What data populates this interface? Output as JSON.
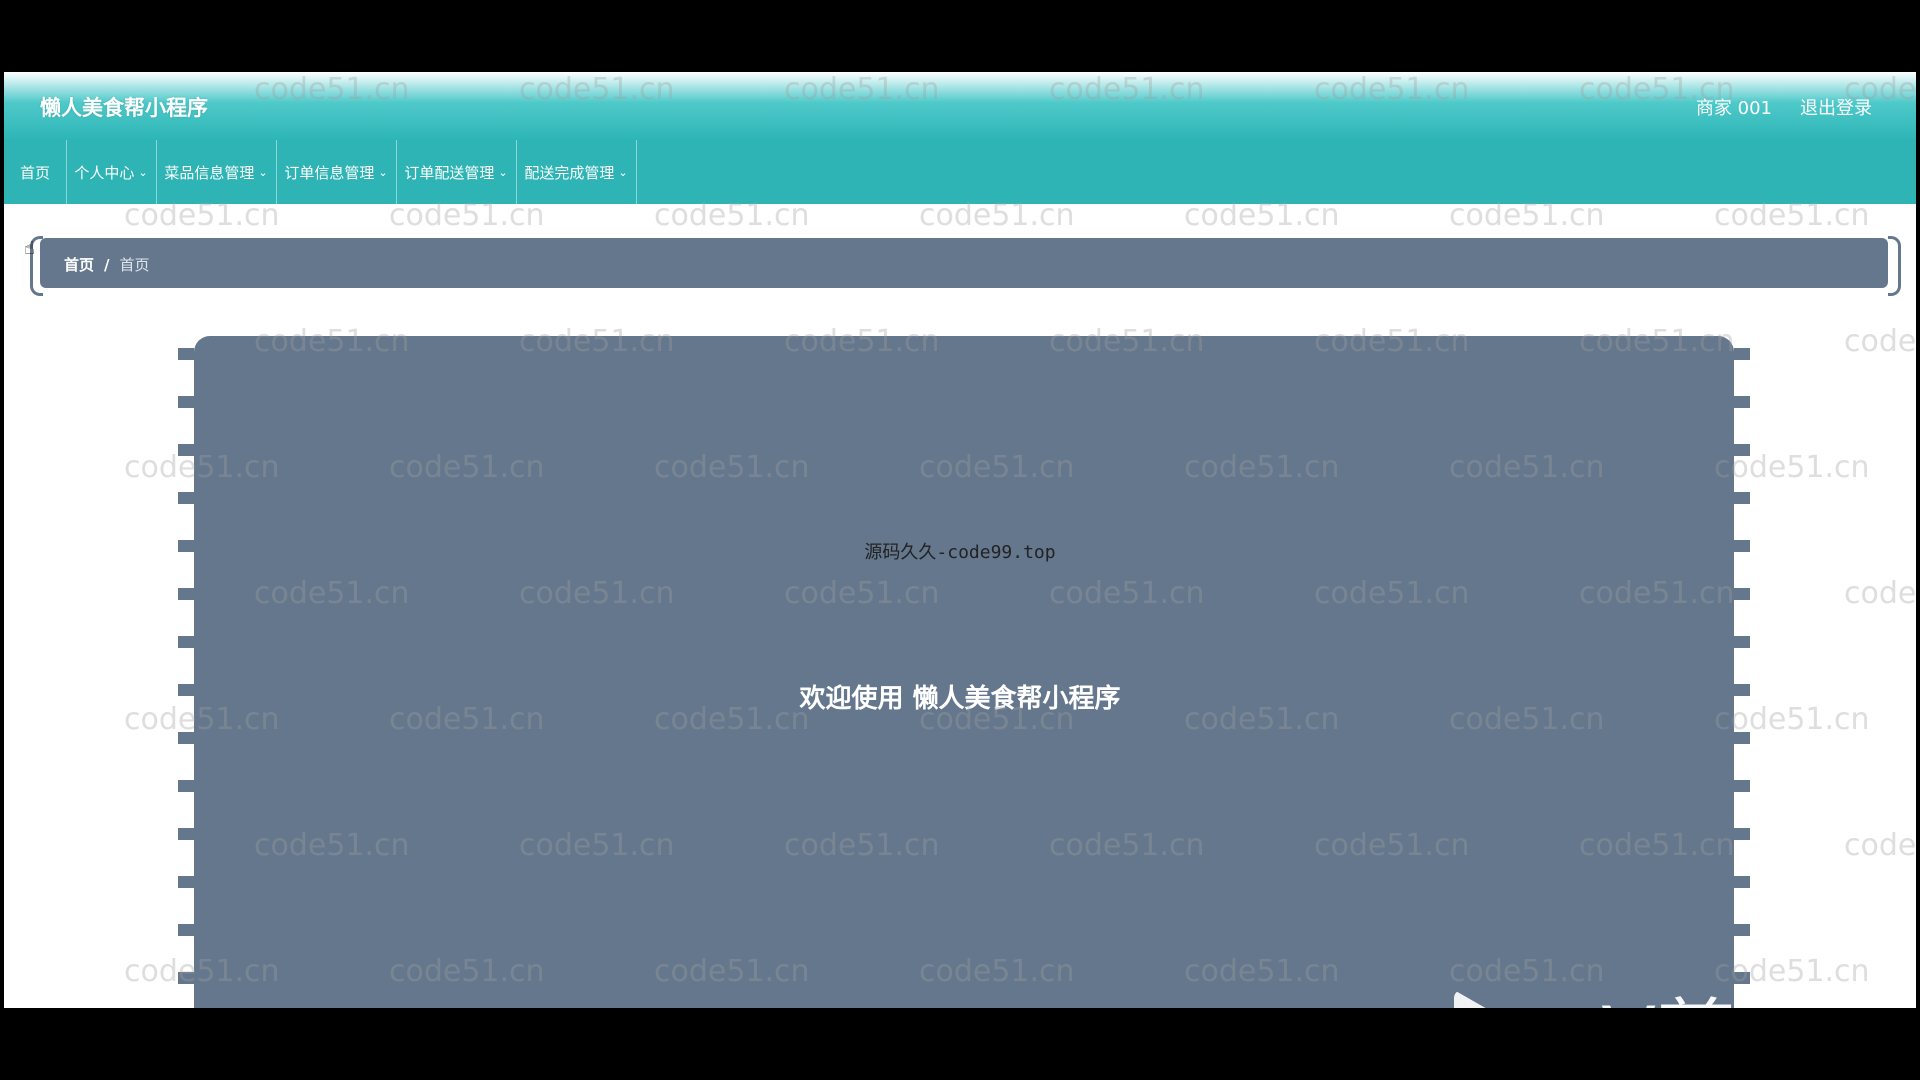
{
  "header": {
    "app_title": "懒人美食帮小程序",
    "user": "商家 001",
    "logout": "退出登录"
  },
  "nav": {
    "items": [
      {
        "label": "首页",
        "has_dropdown": false
      },
      {
        "label": "个人中心",
        "has_dropdown": true
      },
      {
        "label": "菜品信息管理",
        "has_dropdown": true
      },
      {
        "label": "订单信息管理",
        "has_dropdown": true
      },
      {
        "label": "订单配送管理",
        "has_dropdown": true
      },
      {
        "label": "配送完成管理",
        "has_dropdown": true
      }
    ],
    "chevron": "⌄"
  },
  "breadcrumb": {
    "root": "首页",
    "separator": "/",
    "current": "首页"
  },
  "main": {
    "subtitle": "源码久久-code99.top",
    "welcome": "欢迎使用 懒人美食帮小程序"
  },
  "watermark_text": "code51.cn",
  "overlay": {
    "logo_text": "eV剪"
  },
  "colors": {
    "accent": "#2eb4b4",
    "panel": "#64778d"
  }
}
